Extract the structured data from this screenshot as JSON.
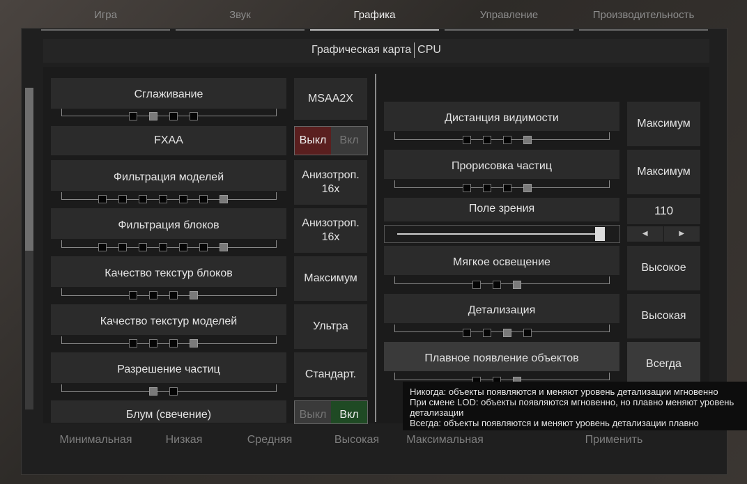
{
  "tabs": [
    "Игра",
    "Звук",
    "Графика",
    "Управление",
    "Производительность"
  ],
  "active_tab": "Графика",
  "subtabs": {
    "gpu": "Графическая карта",
    "cpu": "CPU"
  },
  "left": {
    "antialiasing": {
      "label": "Сглаживание",
      "value": "MSAA2X",
      "level": 2,
      "of": 4
    },
    "fxaa": {
      "label": "FXAA",
      "off": "Выкл",
      "on": "Вкл",
      "state": "off"
    },
    "model_filter": {
      "label": "Фильтрация моделей",
      "value": "Анизотроп. 16x",
      "value_l1": "Анизотроп.",
      "value_l2": "16x",
      "level": 7,
      "of": 7
    },
    "block_filter": {
      "label": "Фильтрация блоков",
      "value_l1": "Анизотроп.",
      "value_l2": "16x",
      "level": 7,
      "of": 7
    },
    "block_tex": {
      "label": "Качество текстур блоков",
      "value": "Максимум",
      "level": 4,
      "of": 4
    },
    "model_tex": {
      "label": "Качество текстур моделей",
      "value": "Ультра",
      "level": 4,
      "of": 4
    },
    "particle_res": {
      "label": "Разрешение частиц",
      "value": "Стандарт.",
      "level": 1,
      "of": 2
    },
    "bloom": {
      "label": "Блум (свечение)",
      "off": "Выкл",
      "on": "Вкл",
      "state": "on"
    }
  },
  "right": {
    "view_dist": {
      "label": "Дистанция видимости",
      "value": "Максимум",
      "level": 4,
      "of": 4
    },
    "particles": {
      "label": "Прорисовка частиц",
      "value": "Максимум",
      "level": 4,
      "of": 4
    },
    "fov": {
      "label": "Поле зрения",
      "value": "110",
      "left_arrow": "◀",
      "right_arrow": "▶"
    },
    "soft_light": {
      "label": "Мягкое освещение",
      "value": "Высокое",
      "level": 3,
      "of": 3
    },
    "detail": {
      "label": "Детализация",
      "value": "Высокая",
      "level": 3,
      "of": 4
    },
    "fade_in": {
      "label": "Плавное появление объектов",
      "value": "Всегда",
      "level": 3,
      "of": 3
    }
  },
  "presets": [
    "Минимальная",
    "Низкая",
    "Средняя",
    "Высокая",
    "Максимальная"
  ],
  "apply": "Применить",
  "tooltip": {
    "line1": "Никогда: объекты появляются и меняют уровень детализации мгновенно",
    "line2": "При смене LOD: объекты появляются мгновенно, но плавно меняют уровень",
    "line3": "детализации",
    "line4": "Всегда: объекты появляются и меняют уровень детализации плавно"
  }
}
